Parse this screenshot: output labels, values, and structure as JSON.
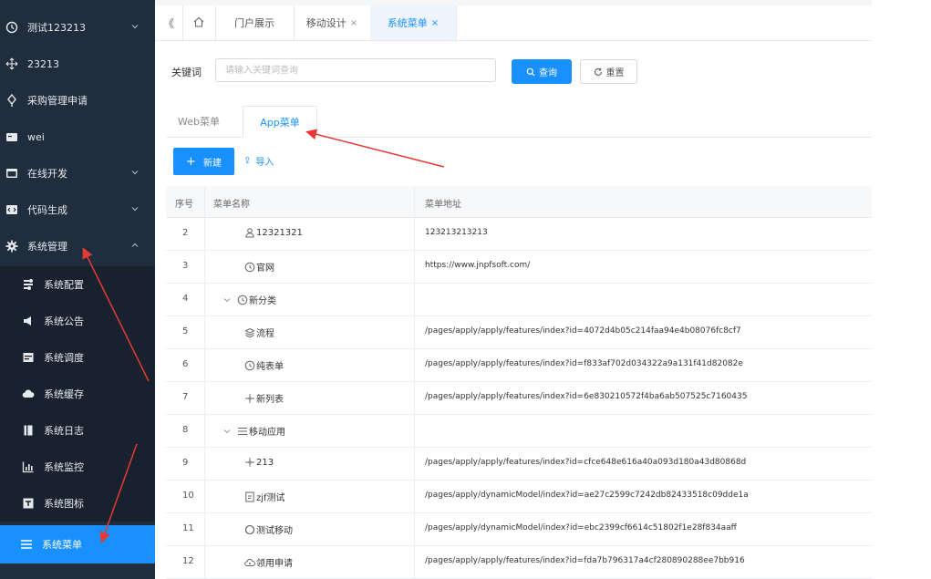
{
  "sidebar": {
    "items": [
      {
        "label": "测试123213",
        "icon": "clock-icon",
        "arrow": "chevron-down-icon"
      },
      {
        "label": "23213",
        "icon": "move-icon",
        "arrow": ""
      },
      {
        "label": "采购管理申请",
        "icon": "diamond-pin-icon",
        "arrow": ""
      },
      {
        "label": "wei",
        "icon": "card-icon",
        "arrow": ""
      },
      {
        "label": "在线开发",
        "icon": "window-icon",
        "arrow": "chevron-down-icon"
      },
      {
        "label": "代码生成",
        "icon": "code-icon",
        "arrow": "chevron-down-icon"
      },
      {
        "label": "系统管理",
        "icon": "gear-icon",
        "arrow": "chevron-up-icon"
      }
    ],
    "sub_items": [
      {
        "label": "系统配置",
        "icon": "settings-icon"
      },
      {
        "label": "系统公告",
        "icon": "announce-icon"
      },
      {
        "label": "系统调度",
        "icon": "schedule-icon"
      },
      {
        "label": "系统缓存",
        "icon": "cloud-icon"
      },
      {
        "label": "系统日志",
        "icon": "log-icon"
      },
      {
        "label": "系统监控",
        "icon": "monitor-icon"
      },
      {
        "label": "系统图标",
        "icon": "image-icon"
      },
      {
        "label": "系统菜单",
        "icon": "menu-icon",
        "active": true
      }
    ]
  },
  "tabs": {
    "collapse_glyph": "《",
    "items": [
      {
        "label": "门户展示",
        "closable": false,
        "active": false
      },
      {
        "label": "移动设计",
        "closable": true,
        "active": false
      },
      {
        "label": "系统菜单",
        "closable": true,
        "active": true
      }
    ],
    "close_glyph": "×"
  },
  "search": {
    "label": "关键词",
    "placeholder": "请输入关键词查询",
    "query_label": "查询",
    "reset_label": "重置"
  },
  "subtabs": [
    {
      "label": "Web菜单",
      "active": false
    },
    {
      "label": "App菜单",
      "active": true
    }
  ],
  "toolbar": {
    "new_label": "新建",
    "new_glyph": "+",
    "import_label": "导入",
    "import_glyph": "⇪"
  },
  "table": {
    "headers": {
      "no": "序号",
      "name": "菜单名称",
      "url": "菜单地址"
    },
    "rows": [
      {
        "no": "2",
        "name": "12321321",
        "icon": "user-icon",
        "level": 1,
        "expander": false,
        "url": "123213213213"
      },
      {
        "no": "3",
        "name": "官网",
        "icon": "clock-icon",
        "level": 1,
        "expander": false,
        "url": "https://www.jnpfsoft.com/"
      },
      {
        "no": "4",
        "name": "新分类",
        "icon": "clock-icon",
        "level": 0,
        "expander": true,
        "url": ""
      },
      {
        "no": "5",
        "name": "流程",
        "icon": "layers-icon",
        "level": 1,
        "expander": false,
        "url": "/pages/apply/apply/features/index?id=4072d4b05c214faa94e4b08076fc8cf7"
      },
      {
        "no": "6",
        "name": "纯表单",
        "icon": "clock-icon",
        "level": 1,
        "expander": false,
        "url": "/pages/apply/apply/features/index?id=f833af702d034322a9a131f41d82082e"
      },
      {
        "no": "7",
        "name": "新列表",
        "icon": "move-icon",
        "level": 1,
        "expander": false,
        "url": "/pages/apply/apply/features/index?id=6e830210572f4ba6ab507525c7160435"
      },
      {
        "no": "8",
        "name": "移动应用",
        "icon": "list-icon",
        "level": 0,
        "expander": true,
        "url": ""
      },
      {
        "no": "9",
        "name": "213",
        "icon": "move-icon",
        "level": 1,
        "expander": false,
        "url": "/pages/apply/apply/features/index?id=cfce648e616a40a093d180a43d80868d"
      },
      {
        "no": "10",
        "name": "zjf测试",
        "icon": "doc-icon",
        "level": 1,
        "expander": false,
        "url": "/pages/apply/dynamicModel/index?id=ae27c2599c7242db82433518c09dde1a"
      },
      {
        "no": "11",
        "name": "测试移动",
        "icon": "circle-icon",
        "level": 1,
        "expander": false,
        "url": "/pages/apply/dynamicModel/index?id=ebc2399cf6614c51802f1e28f834aaff"
      },
      {
        "no": "12",
        "name": "领用申请",
        "icon": "cloud-user-icon",
        "level": 1,
        "expander": false,
        "url": "/pages/apply/apply/features/index?id=fda7b796317a4cf280890288ee7bb916"
      }
    ]
  },
  "colors": {
    "accent": "#1890ff",
    "sidebar_bg": "#1f2d3d",
    "submenu_bg": "#18222e",
    "annotation_arrow": "#e53935"
  }
}
